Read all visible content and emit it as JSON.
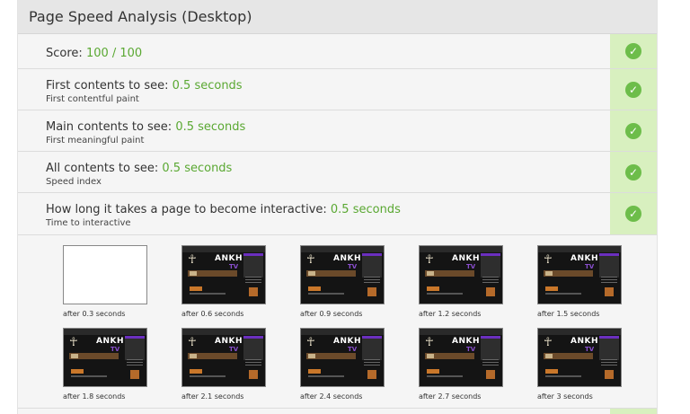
{
  "panel": {
    "title": "Page Speed Analysis (Desktop)"
  },
  "rows": [
    {
      "label": "Score: ",
      "value": "100 / 100",
      "sub": ""
    },
    {
      "label": "First contents to see: ",
      "value": "0.5 seconds",
      "sub": "First contentful paint"
    },
    {
      "label": "Main contents to see: ",
      "value": "0.5 seconds",
      "sub": "First meaningful paint"
    },
    {
      "label": "All contents to see: ",
      "value": "0.5 seconds",
      "sub": "Speed index"
    },
    {
      "label": "How long it takes a page to become interactive: ",
      "value": "0.5 seconds",
      "sub": "Time to interactive"
    }
  ],
  "status_icon": "check-icon",
  "colors": {
    "value_green": "#5aa832",
    "status_bg": "#d8f0bf",
    "check_green": "#6dbd4a",
    "header_bg": "#e6e6e6"
  },
  "thumbnails": [
    {
      "caption": "after 0.3 seconds",
      "blank": true
    },
    {
      "caption": "after 0.6 seconds",
      "blank": false
    },
    {
      "caption": "after 0.9 seconds",
      "blank": false
    },
    {
      "caption": "after 1.2 seconds",
      "blank": false
    },
    {
      "caption": "after 1.5 seconds",
      "blank": false
    },
    {
      "caption": "after 1.8 seconds",
      "blank": false
    },
    {
      "caption": "after 2.1 seconds",
      "blank": false
    },
    {
      "caption": "after 2.4 seconds",
      "blank": false
    },
    {
      "caption": "after 2.7 seconds",
      "blank": false
    },
    {
      "caption": "after 3 seconds",
      "blank": false
    }
  ],
  "thumb_site": {
    "logo": "ANKH",
    "logo_sub": "TV",
    "symbol": "☥"
  }
}
